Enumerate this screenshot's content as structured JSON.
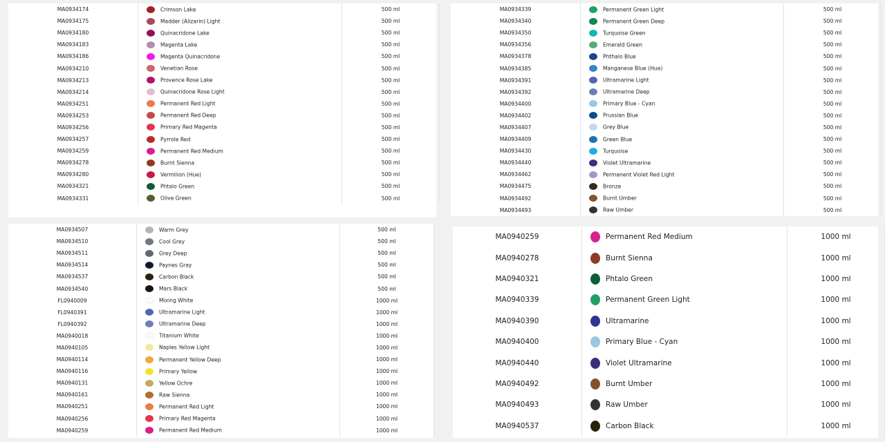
{
  "panels": [
    {
      "size": "small",
      "rows": [
        {
          "code": "MA0934174",
          "name": "Crimson Lake",
          "color": "#a1221c",
          "volume": "500 ml"
        },
        {
          "code": "MA0934175",
          "name": "Madder (Alizarin) Light",
          "color": "#a64b5a",
          "volume": "500 ml"
        },
        {
          "code": "MA0934180",
          "name": "Quinacridone Lake",
          "color": "#8b1557",
          "volume": "500 ml"
        },
        {
          "code": "MA0934183",
          "name": "Magenta Lake",
          "color": "#b28ea8",
          "volume": "500 ml"
        },
        {
          "code": "MA0934186",
          "name": "Magenta Quinacridone",
          "color": "#f21ae8",
          "volume": "500 ml"
        },
        {
          "code": "MA0934210",
          "name": "Venetian Rose",
          "color": "#c86868",
          "volume": "500 ml"
        },
        {
          "code": "MA0934213",
          "name": "Provence Rose Lake",
          "color": "#b0146b",
          "volume": "500 ml"
        },
        {
          "code": "MA0934214",
          "name": "Quinacridone Rose Light",
          "color": "#e8bcd1",
          "volume": "500 ml"
        },
        {
          "code": "MA0934251",
          "name": "Permanent Red Light",
          "color": "#ee7a45",
          "volume": "500 ml"
        },
        {
          "code": "MA0934253",
          "name": "Permanent Red Deep",
          "color": "#c24b48",
          "volume": "500 ml"
        },
        {
          "code": "MA0934256",
          "name": "Primary Red Magenta",
          "color": "#e5344f",
          "volume": "500 ml"
        },
        {
          "code": "MA0934257",
          "name": "Pyrrole Red",
          "color": "#b42a2d",
          "volume": "500 ml"
        },
        {
          "code": "MA0934259",
          "name": "Permanent Red Medium",
          "color": "#d81f8c",
          "volume": "500 ml"
        },
        {
          "code": "MA0934278",
          "name": "Burnt Sienna",
          "color": "#8e3a23",
          "volume": "500 ml"
        },
        {
          "code": "MA0934280",
          "name": "Vermilion (Hue)",
          "color": "#c8194a",
          "volume": "500 ml"
        },
        {
          "code": "MA0934321",
          "name": "Phtalo Green",
          "color": "#0b5e36",
          "volume": "500 ml"
        },
        {
          "code": "MA0934331",
          "name": "Olive Green",
          "color": "#5b5f2d",
          "volume": "500 ml"
        }
      ]
    },
    {
      "size": "small",
      "rows": [
        {
          "code": "MA0934339",
          "name": "Permanent Green Light",
          "color": "#22a062",
          "volume": "500 ml"
        },
        {
          "code": "MA0934340",
          "name": "Permanent Green Deep",
          "color": "#0d8a55",
          "volume": "500 ml"
        },
        {
          "code": "MA0934350",
          "name": "Turquoise Green",
          "color": "#17b6b6",
          "volume": "500 ml"
        },
        {
          "code": "MA0934356",
          "name": "Emerald Green",
          "color": "#5fa777",
          "volume": "500 ml"
        },
        {
          "code": "MA0934378",
          "name": "Phthalo Blue",
          "color": "#20418f",
          "volume": "500 ml"
        },
        {
          "code": "MA0934385",
          "name": "Manganese Blue (Hue)",
          "color": "#3a84c4",
          "volume": "500 ml"
        },
        {
          "code": "MA0934391",
          "name": "Ultramarine Light",
          "color": "#5265b0",
          "volume": "500 ml"
        },
        {
          "code": "MA0934392",
          "name": "Ultramarine Deep",
          "color": "#6d7fb2",
          "volume": "500 ml"
        },
        {
          "code": "MA0934400",
          "name": "Primary Blue - Cyan",
          "color": "#9cc6e4",
          "volume": "500 ml"
        },
        {
          "code": "MA0934402",
          "name": "Prussian Blue",
          "color": "#0d4d8e",
          "volume": "500 ml"
        },
        {
          "code": "MA0934407",
          "name": "Grey Blue",
          "color": "#c3d7f0",
          "volume": "500 ml"
        },
        {
          "code": "MA0934409",
          "name": "Green Blue",
          "color": "#1874b3",
          "volume": "500 ml"
        },
        {
          "code": "MA0934430",
          "name": "Turquoise",
          "color": "#1eaee3",
          "volume": "500 ml"
        },
        {
          "code": "MA0934440",
          "name": "Violet Ultramarine",
          "color": "#3a2f7b",
          "volume": "500 ml"
        },
        {
          "code": "MA0934462",
          "name": "Permanent Violet Red Light",
          "color": "#a893c7",
          "volume": "500 ml"
        },
        {
          "code": "MA0934475",
          "name": "Bronze",
          "color": "#3b2a22",
          "volume": "500 ml"
        },
        {
          "code": "MA0934492",
          "name": "Burnt Umber",
          "color": "#84532e",
          "volume": "500 ml"
        },
        {
          "code": "MA0934493",
          "name": "Raw Umber",
          "color": "#333331",
          "volume": "500 ml"
        }
      ]
    },
    {
      "size": "small",
      "rows": [
        {
          "code": "MA0934507",
          "name": "Warm Grey",
          "color": "#b5b5b5",
          "volume": "500 ml"
        },
        {
          "code": "MA0934510",
          "name": "Cool Grey",
          "color": "#727880",
          "volume": "500 ml"
        },
        {
          "code": "MA0934511",
          "name": "Grey Deep",
          "color": "#616870",
          "volume": "500 ml"
        },
        {
          "code": "MA0934514",
          "name": "Paynes Gray",
          "color": "#0f1a2a",
          "volume": "500 ml"
        },
        {
          "code": "MA0934537",
          "name": "Carbon Black",
          "color": "#2a2010",
          "volume": "500 ml"
        },
        {
          "code": "MA0934540",
          "name": "Mars Black",
          "color": "#151515",
          "volume": "500 ml"
        },
        {
          "code": "FL0940009",
          "name": "Mixing White",
          "color": "#fbfbfb",
          "volume": "1000 ml"
        },
        {
          "code": "FL0940391",
          "name": "Ultramarine Light",
          "color": "#5266b0",
          "volume": "1000 ml"
        },
        {
          "code": "FL0940392",
          "name": "Ultramarine Deep",
          "color": "#7080b3",
          "volume": "1000 ml"
        },
        {
          "code": "MA0940018",
          "name": "Titanium White",
          "color": "#f9f9f9",
          "volume": "1000 ml"
        },
        {
          "code": "MA0940105",
          "name": "Naples Yellow Light",
          "color": "#f7e6a0",
          "volume": "1000 ml"
        },
        {
          "code": "MA0940114",
          "name": "Permanent Yellow Deep",
          "color": "#f3a63b",
          "volume": "1000 ml"
        },
        {
          "code": "MA0940116",
          "name": "Primary Yellow",
          "color": "#f4e32a",
          "volume": "1000 ml"
        },
        {
          "code": "MA0940131",
          "name": "Yellow Ochre",
          "color": "#c6a66c",
          "volume": "1000 ml"
        },
        {
          "code": "MA0940161",
          "name": "Raw Sienna",
          "color": "#b16e2c",
          "volume": "1000 ml"
        },
        {
          "code": "MA0940251",
          "name": "Permanent Red Light",
          "color": "#ee7a45",
          "volume": "1000 ml"
        },
        {
          "code": "MA0940256",
          "name": "Primary Red Magenta",
          "color": "#e5344f",
          "volume": "1000 ml"
        },
        {
          "code": "MA0940259",
          "name": "Permanent Red Medium",
          "color": "#d81f8c",
          "volume": "1000 ml"
        }
      ]
    },
    {
      "size": "large",
      "rows": [
        {
          "code": "MA0940259",
          "name": "Permanent Red Medium",
          "color": "#d81f8c",
          "volume": "1000 ml"
        },
        {
          "code": "MA0940278",
          "name": "Burnt Sienna",
          "color": "#8e3a23",
          "volume": "1000 ml"
        },
        {
          "code": "MA0940321",
          "name": "Phtalo Green",
          "color": "#0b5e36",
          "volume": "1000 ml"
        },
        {
          "code": "MA0940339",
          "name": "Permanent Green Light",
          "color": "#22a062",
          "volume": "1000 ml"
        },
        {
          "code": "MA0940390",
          "name": "Ultramarine",
          "color": "#2c3590",
          "volume": "1000 ml"
        },
        {
          "code": "MA0940400",
          "name": "Primary Blue - Cyan",
          "color": "#9cc6e4",
          "volume": "1000 ml"
        },
        {
          "code": "MA0940440",
          "name": "Violet Ultramarine",
          "color": "#3a2f7b",
          "volume": "1000 ml"
        },
        {
          "code": "MA0940492",
          "name": "Burnt Umber",
          "color": "#84532e",
          "volume": "1000 ml"
        },
        {
          "code": "MA0940493",
          "name": "Raw Umber",
          "color": "#333331",
          "volume": "1000 ml"
        },
        {
          "code": "MA0940537",
          "name": "Carbon Black",
          "color": "#2a2010",
          "volume": "1000 ml"
        }
      ]
    }
  ]
}
